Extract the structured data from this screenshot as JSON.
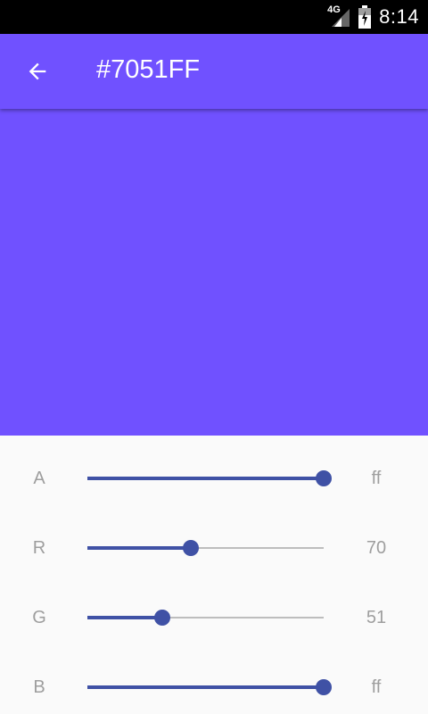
{
  "status": {
    "network": "4G",
    "time": "8:14"
  },
  "colors": {
    "selected": "#7051FF",
    "slider": "#3f51a5",
    "track": "#bdbdbd"
  },
  "app_bar": {
    "title": "#7051FF",
    "back_icon": "arrow-left-icon"
  },
  "sliders": [
    {
      "channel": "A",
      "value": "ff",
      "fraction": 1.0
    },
    {
      "channel": "R",
      "value": "70",
      "fraction": 0.439
    },
    {
      "channel": "G",
      "value": "51",
      "fraction": 0.318
    },
    {
      "channel": "B",
      "value": "ff",
      "fraction": 1.0
    }
  ]
}
